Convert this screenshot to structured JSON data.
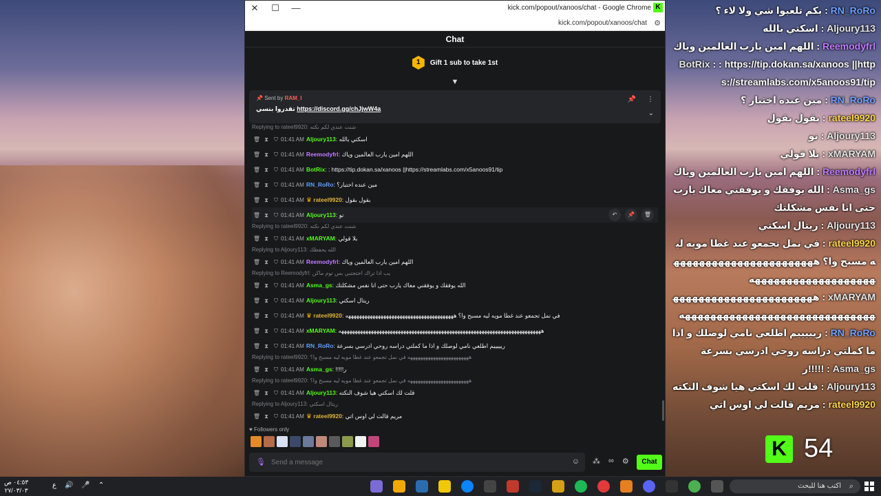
{
  "overlay_lines": [
    {
      "user": "RN_RoRo",
      "color": "blue",
      "sep": " : ",
      "text": "بكم تلعبوا شي ولا لاء ؟"
    },
    {
      "user": "Aljoury113",
      "color": "plain",
      "sep": " : ",
      "text": "اسكتي بالله"
    },
    {
      "user": "Reemodyfrl",
      "color": "purple",
      "sep": " : ",
      "text": "اللهم امين يارب العالمين وياك"
    },
    {
      "user": "BotRix",
      "color": "plain",
      "sep": " : ",
      "text": ": https://tip.dokan.sa/xanoos ||https://streamlabs.com/x5anoos91/tip"
    },
    {
      "user": "RN_RoRo",
      "color": "blue",
      "sep": " : ",
      "text": "مين عنده اختبار ؟"
    },
    {
      "user": "rateel9920",
      "color": "gold",
      "sep": " : ",
      "text": "بقول بقول"
    },
    {
      "user": "Aljoury113",
      "color": "plain",
      "sep": " : ",
      "text": "نو"
    },
    {
      "user": "xMARYAM",
      "color": "plain",
      "sep": " : ",
      "text": "بلا قولي"
    },
    {
      "user": "Reemodyfrl",
      "color": "purple",
      "sep": " : ",
      "text": "اللهم امين يارب العالمين وياك"
    },
    {
      "user": "Asma_gs",
      "color": "plain",
      "sep": " : ",
      "text": "الله يوفقك و يوفقني معاك يارب حتى انا نفس مشكلتك"
    },
    {
      "user": "Aljoury113",
      "color": "plain",
      "sep": " : ",
      "text": "ريتال اسكتي"
    },
    {
      "user": "rateel9920",
      "color": "gold",
      "sep": " : ",
      "text": "في نمل تجمعو عند غطا مويه ليه مسبح وا؟ ههههههههههههههههههههههههههههههههههههههههههه"
    },
    {
      "user": "xMARYAM",
      "color": "plain",
      "sep": " : ",
      "text": "هههههههههههههههههههههههههههههههههههههههههههههههههههههه"
    },
    {
      "user": "RN_RoRo",
      "color": "blue",
      "sep": " : ",
      "text": "ريييييم اطلعي نامي لوصلك و اذا ما كملتي دراسه روحي ادرسي بسرعة"
    },
    {
      "user": "Asma_gs",
      "color": "plain",
      "sep": " : ",
      "text": "!!!!!ر"
    },
    {
      "user": "Aljoury113",
      "color": "plain",
      "sep": " : ",
      "text": "قلت لك اسكتي هيا شوف النكته"
    },
    {
      "user": "rateel9920",
      "color": "gold",
      "sep": " : ",
      "text": "مريم قالت لي اوس اتي"
    }
  ],
  "viewer_count": "54",
  "window": {
    "title": "kick.com/popout/xanoos/chat - Google Chrome",
    "url": "kick.com/popout/xanoos/chat",
    "close_glyph": "✕",
    "max_glyph": "☐",
    "min_glyph": "—"
  },
  "chat": {
    "header": "Chat",
    "gift_coin": "1",
    "gift_text": "Gift 1 sub to take 1st",
    "pinned": {
      "sent_by_label": "Sent by",
      "sent_by_user": "RAM_I",
      "prefix": "تقدروا بنسي",
      "link": "https://discord.gg/chJjwW4a"
    },
    "messages": [
      {
        "reply": "Replying to rateel9920: شنت عندي لكم نكته",
        "time": "01:41 AM",
        "user": "Aljoury113",
        "color": "c-green",
        "crown": false,
        "text": "اسكتي بالله"
      },
      {
        "reply": "",
        "time": "01:41 AM",
        "user": "Reemodyfrl",
        "color": "c-purple",
        "crown": false,
        "text": "اللهم امين يارب العالمين وياك"
      },
      {
        "reply": "",
        "time": "01:41 AM",
        "user": "BotRix",
        "color": "c-teal",
        "crown": false,
        "text": ": https://tip.dokan.sa/xanoos ||https://streamlabs.com/x5anoos91/tip"
      },
      {
        "reply": "",
        "time": "01:41 AM",
        "user": "RN_RoRo",
        "color": "c-blue",
        "crown": false,
        "text": "مين عنده اختبار؟"
      },
      {
        "reply": "",
        "time": "01:41 AM",
        "user": "rateel9920",
        "color": "c-gold",
        "crown": true,
        "text": "بقول بقول"
      },
      {
        "reply": "",
        "time": "01:41 AM",
        "user": "Aljoury113",
        "color": "c-green",
        "crown": false,
        "text": "نو",
        "hover": true
      },
      {
        "reply": "Replying to rateel9920: شنت عندي لكم نكته",
        "time": "01:41 AM",
        "user": "xMARYAM",
        "color": "c-green",
        "crown": false,
        "text": "بلا قولي"
      },
      {
        "reply": "Replying to Aljoury113: الله يحفظك",
        "time": "01:41 AM",
        "user": "Reemodyfrl",
        "color": "c-purple",
        "crown": false,
        "text": "اللهم امين يارب العالمين وياك"
      },
      {
        "reply": "Replying to Reemodyfrl: يب اذا تراك احتجتبي بس نوم ماكن",
        "time": "01:41 AM",
        "user": "Asma_gs",
        "color": "c-green",
        "crown": false,
        "text": "الله يوفقك و يوفقني معاك يارب حتى انا نفس مشكلتك"
      },
      {
        "reply": "",
        "time": "01:41 AM",
        "user": "Aljoury113",
        "color": "c-green",
        "crown": false,
        "text": "ريتال اسكتي"
      },
      {
        "reply": "",
        "time": "01:41 AM",
        "user": "rateel9920",
        "color": "c-gold",
        "crown": true,
        "text": "في نمل تجمعو عند غطا مويه ليه مسبح وا؟ ههههههههههههههههههههههههههههههههههههههههه"
      },
      {
        "reply": "",
        "time": "01:41 AM",
        "user": "xMARYAM",
        "color": "c-green",
        "crown": false,
        "text": "هههههههههههههههههههههههههههههههههههههههههههههههههههههههههههههههههههههههههههه"
      },
      {
        "reply": "",
        "time": "01:41 AM",
        "user": "RN_RoRo",
        "color": "c-blue",
        "crown": false,
        "text": "ريييييم اطلعي نامي لوصلك و اذا ما كملتي دراسه روحي ادرسي بسرعة"
      },
      {
        "reply": "Replying to rateel9920: ههههههههههههههههههههههههه في نمل تجمعو عند غطا مويه ليه مسبح وا؟",
        "time": "01:41 AM",
        "user": "Asma_gs",
        "color": "c-green",
        "crown": false,
        "text": "!!!!!ر"
      },
      {
        "reply": "Replying to rateel9920: ههههههههههههههههههههههههه في نمل تجمعو عند غطا مويه ليه مسبح وا؟",
        "time": "01:41 AM",
        "user": "Aljoury113",
        "color": "c-green",
        "crown": false,
        "text": "قلت لك اسكتي هيا شوف النكته"
      },
      {
        "reply": "Replying to Aljoury113: ريتال اسكتي",
        "time": "01:41 AM",
        "user": "rateel9920",
        "color": "c-gold",
        "crown": true,
        "text": "مريم قالت لي اوس اتي"
      }
    ],
    "followers_only": "Followers only",
    "composer_placeholder": "Send a message",
    "chat_button": "Chat",
    "infinity_label": "∞"
  },
  "taskbar": {
    "time": "٠٤:٥٣ ص",
    "date": "٢٧/٠٣/٠٣",
    "lang": "ع",
    "search_placeholder": "اكتب هنا للبحث"
  }
}
